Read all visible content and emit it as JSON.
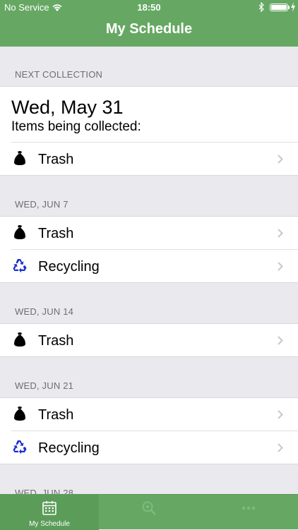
{
  "status_bar": {
    "carrier": "No Service",
    "time": "18:50"
  },
  "nav": {
    "title": "My Schedule"
  },
  "next_collection": {
    "header": "NEXT COLLECTION",
    "date": "Wed, May 31",
    "subtitle": "Items being collected:",
    "items": [
      {
        "label": "Trash",
        "icon": "trash-bag-icon"
      }
    ]
  },
  "schedule": [
    {
      "header": "WED, JUN 7",
      "items": [
        {
          "label": "Trash",
          "icon": "trash-bag-icon"
        },
        {
          "label": "Recycling",
          "icon": "recycling-icon"
        }
      ]
    },
    {
      "header": "WED, JUN 14",
      "items": [
        {
          "label": "Trash",
          "icon": "trash-bag-icon"
        }
      ]
    },
    {
      "header": "WED, JUN 21",
      "items": [
        {
          "label": "Trash",
          "icon": "trash-bag-icon"
        },
        {
          "label": "Recycling",
          "icon": "recycling-icon"
        }
      ]
    },
    {
      "header": "WED, JUN 28",
      "items": []
    }
  ],
  "tabbar": {
    "tabs": [
      {
        "label": "My Schedule",
        "icon": "calendar-icon",
        "active": true
      },
      {
        "label": "",
        "icon": "search-icon",
        "active": false
      },
      {
        "label": "",
        "icon": "more-icon",
        "active": false
      }
    ]
  },
  "colors": {
    "brand_green": "#66a863",
    "recycling_blue": "#1a2fd0"
  }
}
